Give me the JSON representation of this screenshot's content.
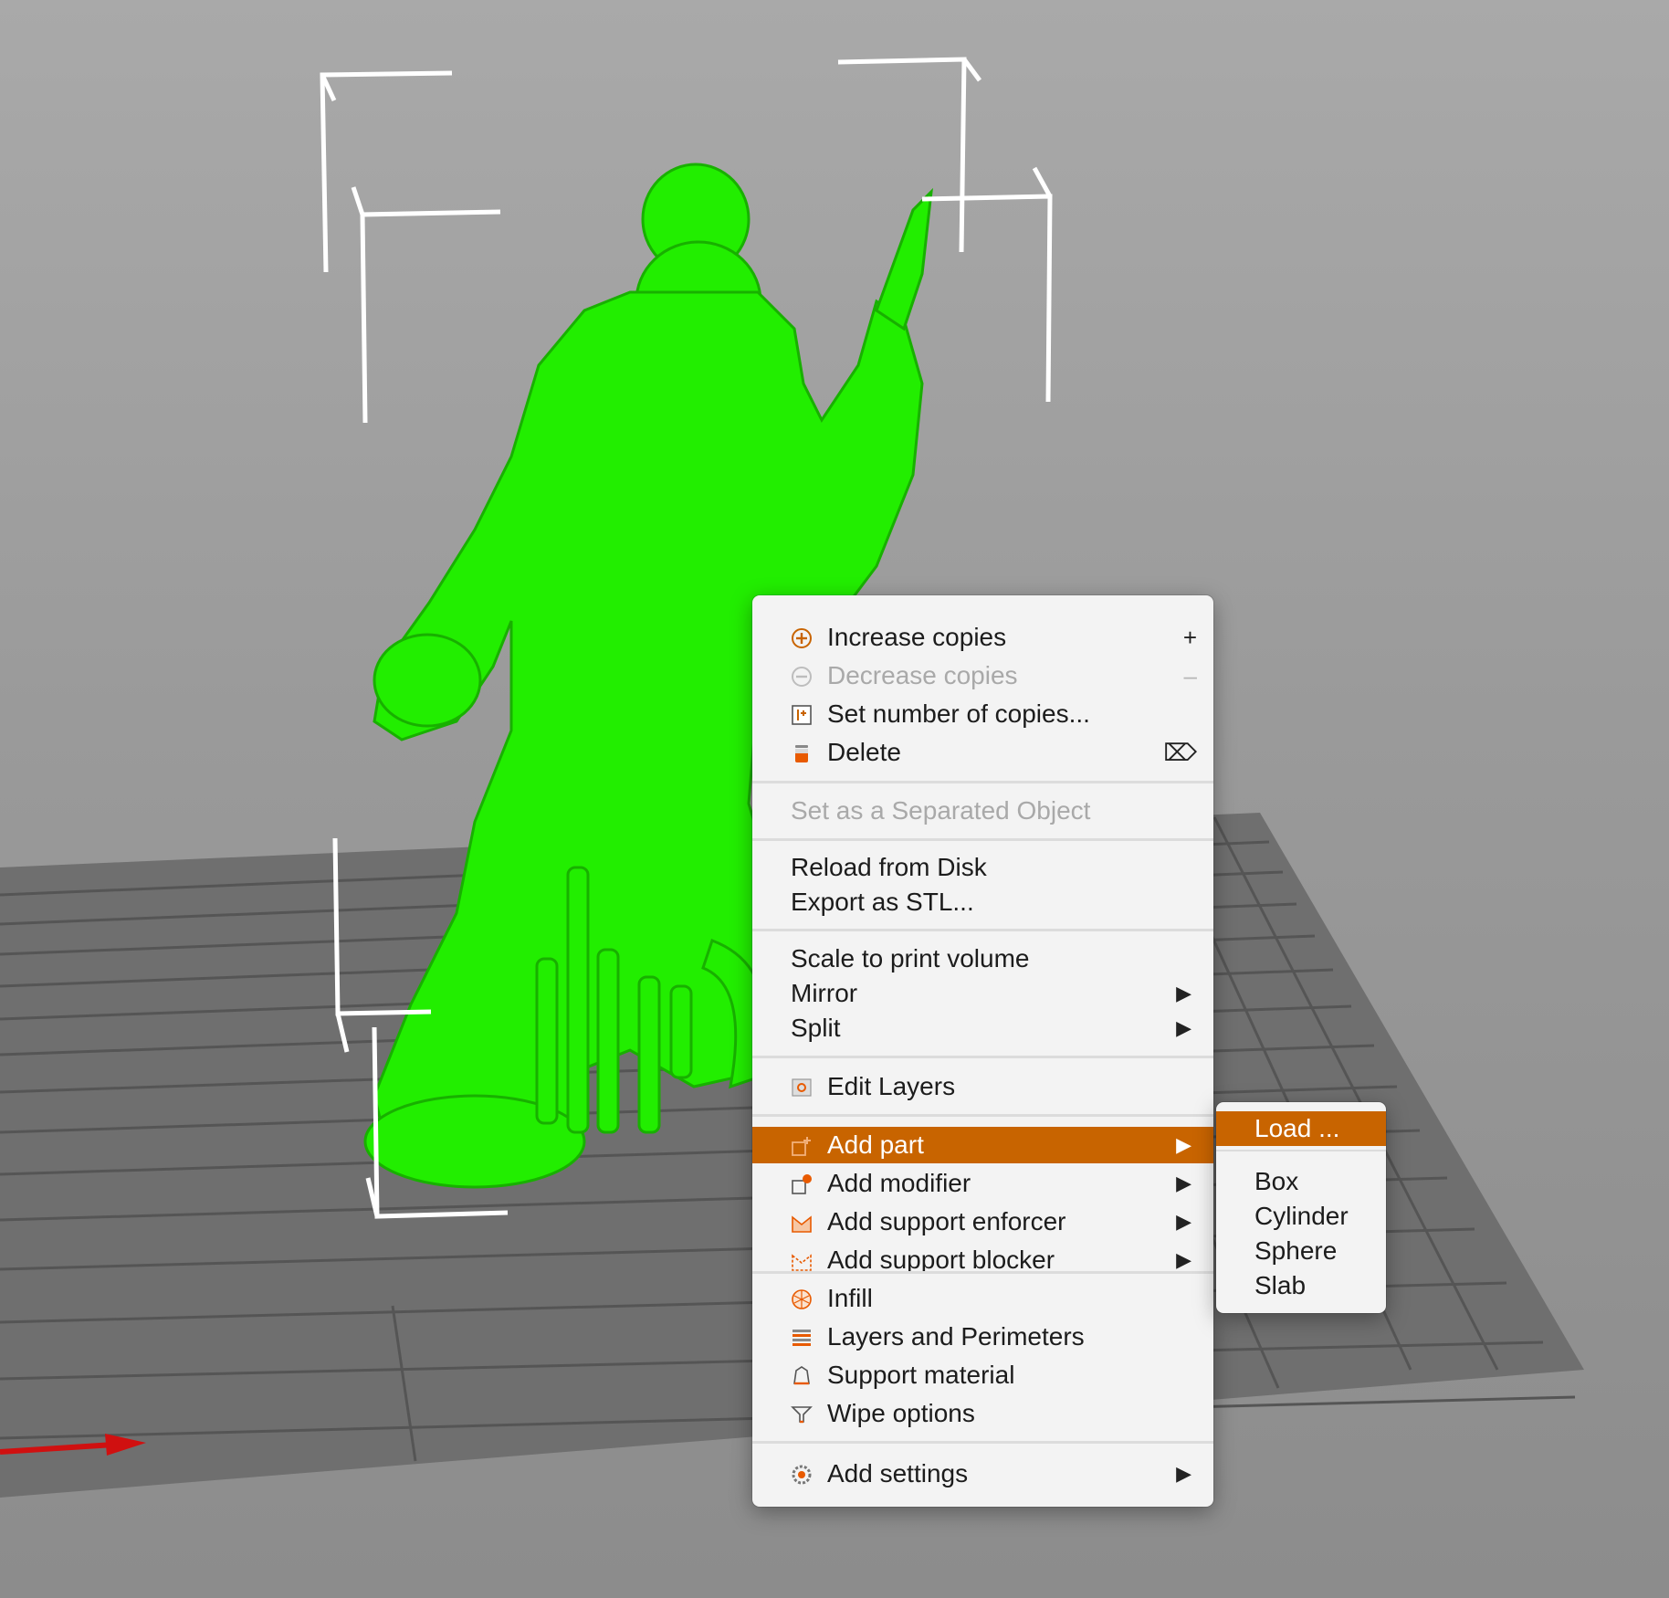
{
  "scene": {
    "model_color": "#22ee00",
    "bed_color": "#6f6f6f",
    "bed_grid_color": "#555555",
    "bbox_color": "#ffffff",
    "x_axis_color": "#d01010"
  },
  "context_menu": {
    "highlight_color": "#c86400",
    "items": [
      {
        "label": "Increase copies",
        "shortcut": "+",
        "icon": "plus-circle-icon"
      },
      {
        "label": "Decrease copies",
        "shortcut": "–",
        "icon": "minus-circle-icon",
        "disabled": true
      },
      {
        "label": "Set number of copies...",
        "icon": "copies-icon"
      },
      {
        "label": "Delete",
        "shortcut": "⌦",
        "icon": "trash-icon"
      },
      {
        "label": "Set as a Separated Object",
        "disabled": true
      },
      {
        "label": "Reload from Disk"
      },
      {
        "label": "Export as STL..."
      },
      {
        "label": "Scale to print volume"
      },
      {
        "label": "Mirror",
        "submenu": true
      },
      {
        "label": "Split",
        "submenu": true
      },
      {
        "label": "Edit Layers",
        "icon": "edit-layers-icon"
      },
      {
        "label": "Add part",
        "submenu": true,
        "icon": "add-part-icon",
        "highlighted": true
      },
      {
        "label": "Add modifier",
        "submenu": true,
        "icon": "add-modifier-icon"
      },
      {
        "label": "Add support enforcer",
        "submenu": true,
        "icon": "support-enforcer-icon"
      },
      {
        "label": "Add support blocker",
        "submenu": true,
        "icon": "support-blocker-icon"
      },
      {
        "label": "Infill",
        "icon": "infill-icon"
      },
      {
        "label": "Layers and Perimeters",
        "icon": "layers-icon"
      },
      {
        "label": "Support material",
        "icon": "support-material-icon"
      },
      {
        "label": "Wipe options",
        "icon": "wipe-icon"
      },
      {
        "label": "Add settings",
        "submenu": true,
        "icon": "settings-gear-icon"
      }
    ]
  },
  "submenu": {
    "items": [
      {
        "label": "Load ...",
        "highlighted": true
      },
      {
        "label": "Box"
      },
      {
        "label": "Cylinder"
      },
      {
        "label": "Sphere"
      },
      {
        "label": "Slab"
      }
    ]
  }
}
